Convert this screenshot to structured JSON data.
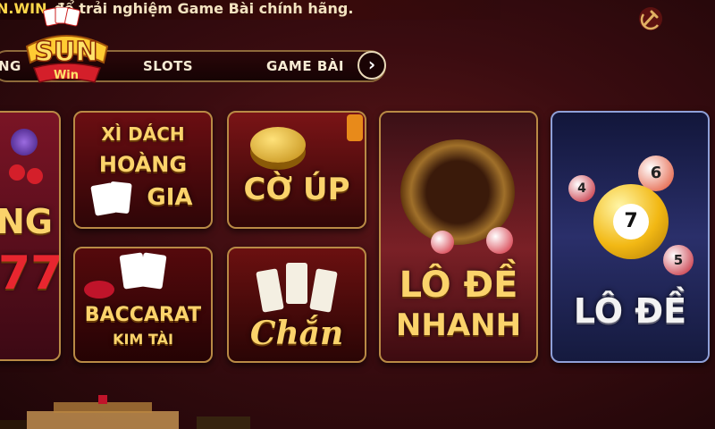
{
  "marquee": {
    "highlight": "N.WIN",
    "text": "để trải nghiệm Game Bài chính hãng."
  },
  "logo": {
    "text": "SUN",
    "sub": "Win"
  },
  "nav": {
    "items": [
      {
        "label": "NG"
      },
      {
        "label": "SLOTS"
      },
      {
        "label": "GAME BÀI"
      }
    ],
    "next_icon": "›"
  },
  "slots_tile": {
    "partial_text": "NG",
    "partial_num": "77"
  },
  "games": [
    {
      "line1": "XÌ DÁCH",
      "line2": "HOÀNG",
      "line3": "GIA"
    },
    {
      "line1": "CỜ ÚP"
    },
    {
      "line1": "BACCARAT",
      "line2": "KIM TÀI"
    },
    {
      "line1": "Chắn"
    },
    {
      "line1": "LÔ ĐỀ",
      "line2": "NHANH"
    },
    {
      "line1": "LÔ ĐỀ"
    }
  ],
  "balls": [
    "6",
    "7",
    "4",
    "5"
  ],
  "colors": {
    "gold": "#fbd36b",
    "accent_red": "#c0142a",
    "frame": "#b98a45"
  }
}
